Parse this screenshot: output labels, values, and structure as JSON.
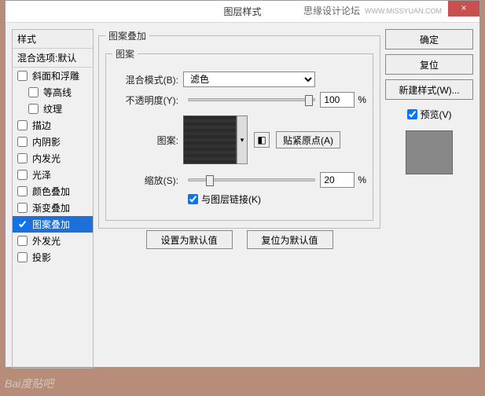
{
  "title": "图层样式",
  "brand": "思缘设计论坛",
  "brand_url": "WWW.MISSYUAN.COM",
  "close": "×",
  "left": {
    "styles_header": "样式",
    "blend_header": "混合选项:默认",
    "items": [
      {
        "label": "斜面和浮雕",
        "checked": false,
        "indent": false
      },
      {
        "label": "等高线",
        "checked": false,
        "indent": true
      },
      {
        "label": "纹理",
        "checked": false,
        "indent": true
      },
      {
        "label": "描边",
        "checked": false,
        "indent": false
      },
      {
        "label": "内阴影",
        "checked": false,
        "indent": false
      },
      {
        "label": "内发光",
        "checked": false,
        "indent": false
      },
      {
        "label": "光泽",
        "checked": false,
        "indent": false
      },
      {
        "label": "颜色叠加",
        "checked": false,
        "indent": false
      },
      {
        "label": "渐变叠加",
        "checked": false,
        "indent": false
      },
      {
        "label": "图案叠加",
        "checked": true,
        "indent": false,
        "selected": true
      },
      {
        "label": "外发光",
        "checked": false,
        "indent": false
      },
      {
        "label": "投影",
        "checked": false,
        "indent": false
      }
    ]
  },
  "center": {
    "outer_legend": "图案叠加",
    "inner_legend": "图案",
    "blend_mode_label": "混合模式(B):",
    "blend_mode_value": "滤色",
    "opacity_label": "不透明度(Y):",
    "opacity_value": "100",
    "pct": "%",
    "pattern_label": "图案:",
    "snap_btn": "贴紧原点(A)",
    "scale_label": "缩放(S):",
    "scale_value": "20",
    "link_label": "与图层链接(K)",
    "link_checked": true,
    "set_default": "设置为默认值",
    "reset_default": "复位为默认值"
  },
  "right": {
    "ok": "确定",
    "cancel": "复位",
    "newstyle": "新建样式(W)...",
    "preview_label": "预览(V)",
    "preview_checked": true
  },
  "watermark": "Bai度贴吧"
}
